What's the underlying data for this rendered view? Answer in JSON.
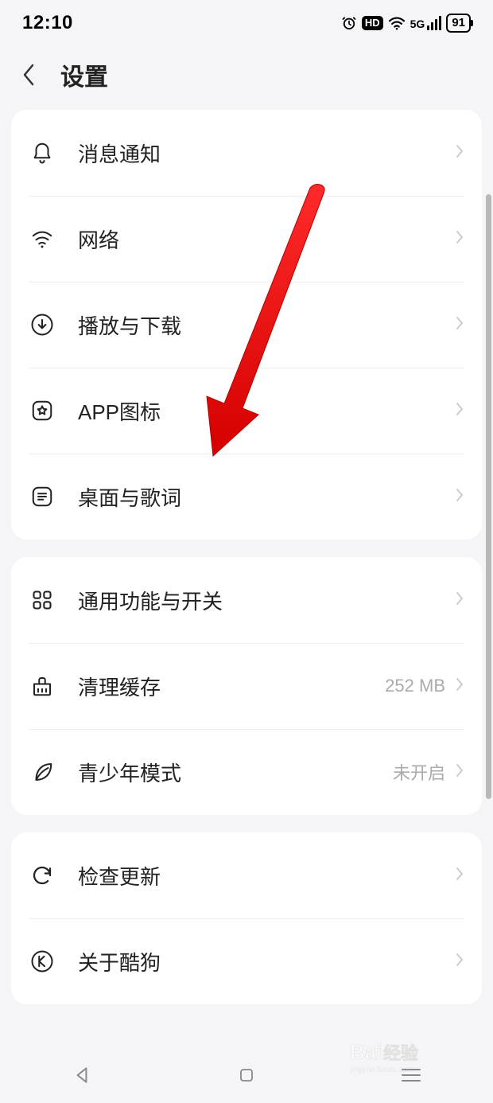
{
  "statusbar": {
    "time": "12:10",
    "signal_label": "5G",
    "battery_level": "91"
  },
  "header": {
    "title": "设置"
  },
  "groups": [
    {
      "rows": [
        {
          "key": "notifications",
          "icon": "bell",
          "label": "消息通知",
          "value": ""
        },
        {
          "key": "network",
          "icon": "wifi",
          "label": "网络",
          "value": ""
        },
        {
          "key": "playback-download",
          "icon": "download",
          "label": "播放与下载",
          "value": ""
        },
        {
          "key": "app-icon",
          "icon": "star-square",
          "label": "APP图标",
          "value": ""
        },
        {
          "key": "desktop-lyrics",
          "icon": "list-square",
          "label": "桌面与歌词",
          "value": ""
        }
      ]
    },
    {
      "rows": [
        {
          "key": "general-switches",
          "icon": "grid",
          "label": "通用功能与开关",
          "value": ""
        },
        {
          "key": "clear-cache",
          "icon": "broom",
          "label": "清理缓存",
          "value": "252 MB"
        },
        {
          "key": "youth-mode",
          "icon": "leaf",
          "label": "青少年模式",
          "value": "未开启"
        }
      ]
    },
    {
      "rows": [
        {
          "key": "check-update",
          "icon": "refresh",
          "label": "检查更新",
          "value": ""
        },
        {
          "key": "about-kugou",
          "icon": "k-circle",
          "label": "关于酷狗",
          "value": ""
        }
      ]
    }
  ],
  "annotation": {
    "arrow_target": "desktop-lyrics",
    "arrow_color": "#ff0000"
  },
  "watermark": {
    "text_main": "Bai",
    "text_sub": "经验",
    "domain": "jingyan.baidu.com"
  }
}
